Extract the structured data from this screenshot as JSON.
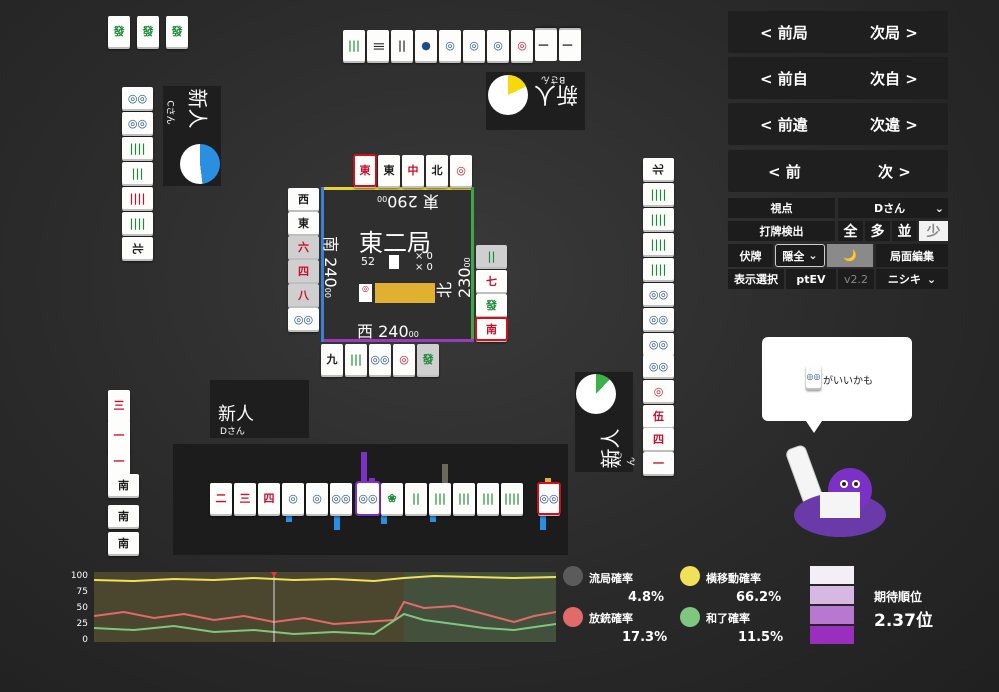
{
  "nav": {
    "prev_round": "< 前局",
    "next_round": "次局 >",
    "prev_self": "< 前自",
    "next_self": "次自 >",
    "prev_diff": "< 前違",
    "next_diff": "次違 >",
    "prev": "< 前",
    "next": "次 >"
  },
  "controls": {
    "viewpoint_label": "視点",
    "viewpoint_value": "Dさん",
    "discard_detect_label": "打牌検出",
    "discard_options": [
      "全",
      "多",
      "並",
      "少"
    ],
    "hidden_label": "伏牌",
    "hidden_value": "隠全",
    "moon_icon": "🌙",
    "edit_label": "局面編集",
    "display_label": "表示選択",
    "display_value": "ptEV",
    "version": "v2.2",
    "model_value": "ニシキ"
  },
  "board": {
    "round": "東二局",
    "tiles_left": "52",
    "honba": "× 0",
    "riichi": "× 0",
    "scores": {
      "top": {
        "wind": "東",
        "score": "290",
        "suffix": "00"
      },
      "left": {
        "wind": "南",
        "score": "240",
        "suffix": "00"
      },
      "right": {
        "wind": "北",
        "score": "230",
        "suffix": "00"
      },
      "bottom": {
        "wind": "西",
        "score": "240",
        "suffix": "00"
      }
    }
  },
  "players": {
    "top": {
      "rank": "新人",
      "name": "Bさん"
    },
    "left": {
      "rank": "新人",
      "name": "Cさん"
    },
    "bottom": {
      "rank": "新人",
      "name": "Dさん"
    },
    "right": {
      "rank": "新人",
      "name": "Aさん"
    }
  },
  "hint": {
    "text": "がいいかも"
  },
  "stats": {
    "draw_label": "流局確率",
    "draw_value": "4.8%",
    "move_label": "横移動確率",
    "move_value": "66.2%",
    "deal_in_label": "放銃確率",
    "deal_in_value": "17.3%",
    "win_label": "和了確率",
    "win_value": "11.5%",
    "expected_rank_label": "期待順位",
    "expected_rank_value": "2.37位",
    "colors": {
      "draw": "#5b5b5b",
      "move": "#f2e05a",
      "deal_in": "#e36a6a",
      "win": "#7fc77f"
    }
  },
  "graph": {
    "y_ticks": [
      "100",
      "75",
      "50",
      "25",
      "0"
    ]
  }
}
